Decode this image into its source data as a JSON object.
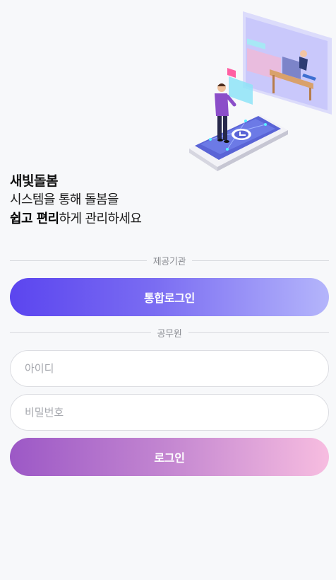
{
  "intro": {
    "brand": "새빛돌봄",
    "line2": "시스템을 통해 돌봄을",
    "line3_bold": "쉽고 편리",
    "line3_rest": "하게 관리하세요"
  },
  "provider_section": {
    "divider_label": "제공기관",
    "sso_button_label": "통합로그인"
  },
  "official_section": {
    "divider_label": "공무원",
    "id_placeholder": "아이디",
    "password_placeholder": "비밀번호",
    "login_button_label": "로그인"
  },
  "colors": {
    "sso_gradient": [
      "#5b45ef",
      "#b4b5fb"
    ],
    "login_gradient": [
      "#9c58c6",
      "#f7bde0"
    ],
    "background": "#f7f8fa"
  },
  "icons": {
    "illustration": "person-with-tablet-illustration"
  }
}
